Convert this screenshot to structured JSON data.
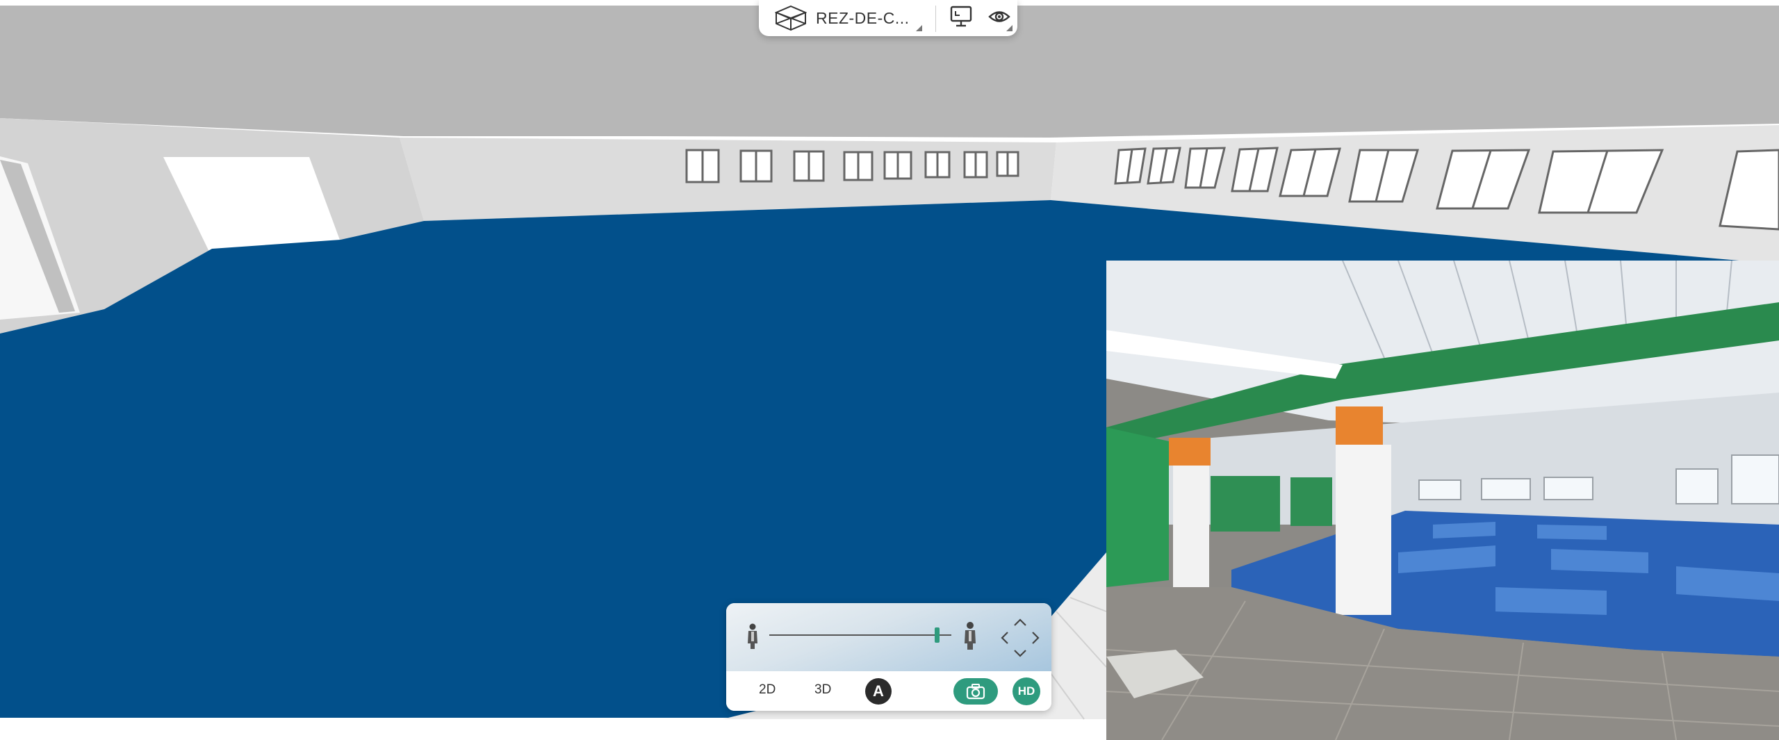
{
  "toolbar": {
    "level_label": "REZ-DE-C...",
    "level_icon": "cube-icon",
    "screen_icon": "screen-icon",
    "view_icon": "eye-icon"
  },
  "controls": {
    "mode_2d": "2D",
    "mode_3d": "3D",
    "auto_label": "A",
    "hd_label": "HD",
    "height_slider_level": 0.92,
    "camera_icon": "camera-icon",
    "nav_icon": "arrows-nav-icon",
    "person_small_icon": "person-small-icon",
    "person_large_icon": "person-large-icon"
  },
  "colors": {
    "accent": "#2e9b7e",
    "floor_mat": "#02508b",
    "ceiling": "#b9b9b9",
    "wall": "#dedede"
  }
}
